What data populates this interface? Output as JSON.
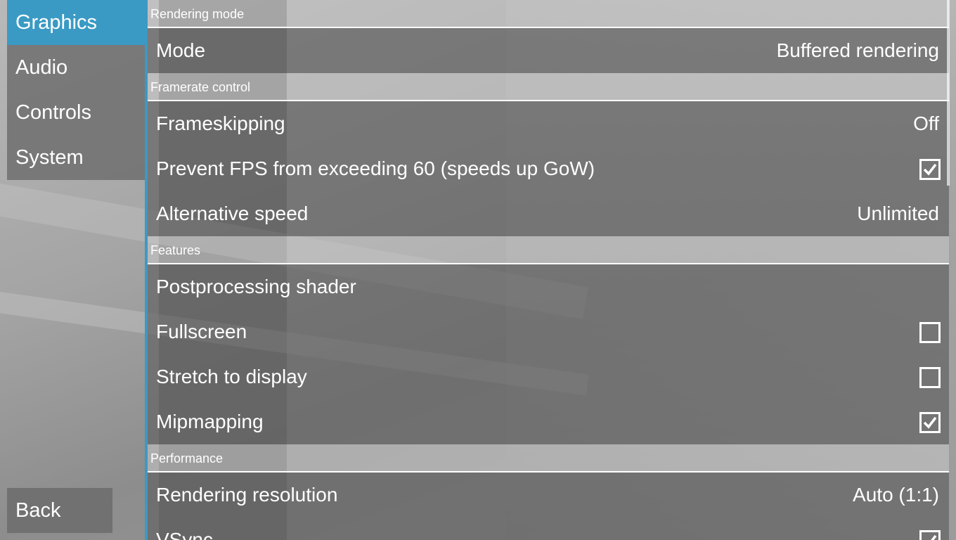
{
  "sidebar": {
    "tabs": [
      {
        "label": "Graphics",
        "active": true
      },
      {
        "label": "Audio",
        "active": false
      },
      {
        "label": "Controls",
        "active": false
      },
      {
        "label": "System",
        "active": false
      }
    ],
    "back_label": "Back"
  },
  "settings": {
    "sections": [
      {
        "title": "Rendering mode",
        "rows": [
          {
            "label": "Mode",
            "value": "Buffered rendering"
          }
        ]
      },
      {
        "title": "Framerate control",
        "rows": [
          {
            "label": "Frameskipping",
            "value": "Off"
          },
          {
            "label": "Prevent FPS from exceeding 60 (speeds up GoW)",
            "checked": true
          },
          {
            "label": "Alternative speed",
            "value": "Unlimited"
          }
        ]
      },
      {
        "title": "Features",
        "rows": [
          {
            "label": "Postprocessing shader"
          },
          {
            "label": "Fullscreen",
            "checked": false
          },
          {
            "label": "Stretch to display",
            "checked": false
          },
          {
            "label": "Mipmapping",
            "checked": true
          }
        ]
      },
      {
        "title": "Performance",
        "rows": [
          {
            "label": "Rendering resolution",
            "value": "Auto (1:1)"
          },
          {
            "label": "VSync",
            "checked": true
          }
        ]
      }
    ]
  },
  "colors": {
    "accent": "#3a9ac4",
    "row_bg": "#646464",
    "header_bg": "#c8c8c8"
  }
}
